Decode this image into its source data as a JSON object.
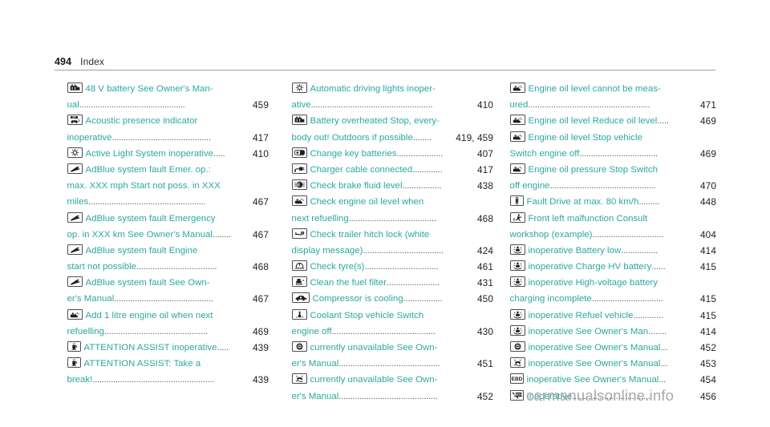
{
  "header": {
    "page_number": "494",
    "section_title": "Index"
  },
  "colors": {
    "entry_text": "#2aa7a4",
    "page_number": "#222222",
    "leader_dots": "#5c5c5c",
    "rule": "#9aa0a0",
    "watermark": "#a8a8a8"
  },
  "watermark": "carmanualsonline.info",
  "columns": [
    {
      "id": "column-1",
      "entries": [
        {
          "icon": "battery-48v-icon",
          "lines": [
            {
              "text": "48 V battery See Owner's Man-",
              "leader": "",
              "page": ""
            },
            {
              "text": "ual",
              "leader": "..............................................",
              "page": "459"
            }
          ]
        },
        {
          "icon": "acoustic-presence-indicator-icon",
          "lines": [
            {
              "text": "Acoustic presence indicator",
              "leader": "",
              "page": ""
            },
            {
              "text": "inoperative",
              "leader": "...........................................",
              "page": "417"
            }
          ]
        },
        {
          "icon": "headlamp-icon",
          "lines": [
            {
              "text": "Active Light System inoperative",
              "leader": ".....",
              "page": "410"
            }
          ]
        },
        {
          "icon": "wrench-icon",
          "lines": [
            {
              "text": "AdBlue system fault Emer. op.:",
              "leader": "",
              "page": ""
            },
            {
              "text": "max. XXX mph Start not poss. in XXX",
              "leader": "",
              "page": ""
            },
            {
              "text": "miles",
              "leader": "...................................................",
              "page": "467"
            }
          ]
        },
        {
          "icon": "wrench-icon",
          "lines": [
            {
              "text": "AdBlue system fault Emergency",
              "leader": "",
              "page": ""
            },
            {
              "text": "op. in XXX km See Owner's Manual",
              "leader": "........",
              "page": "467"
            }
          ]
        },
        {
          "icon": "wrench-icon",
          "lines": [
            {
              "text": "AdBlue system fault Engine",
              "leader": "",
              "page": ""
            },
            {
              "text": "start not possible",
              "leader": "...................................",
              "page": "468"
            }
          ]
        },
        {
          "icon": "wrench-icon",
          "lines": [
            {
              "text": "AdBlue system fault See Own-",
              "leader": "",
              "page": ""
            },
            {
              "text": "er's Manual",
              "leader": "...........................................",
              "page": "467"
            }
          ]
        },
        {
          "icon": "oil-can-icon",
          "lines": [
            {
              "text": "Add 1 litre engine oil when next",
              "leader": "",
              "page": ""
            },
            {
              "text": "refuelling",
              "leader": ".............................................",
              "page": "469"
            }
          ]
        },
        {
          "icon": "attention-assist-coffee-icon",
          "lines": [
            {
              "text": "ATTENTION ASSIST inoperative",
              "leader": ".....",
              "page": "439"
            }
          ]
        },
        {
          "icon": "attention-assist-coffee-icon",
          "lines": [
            {
              "text": "ATTENTION ASSIST: Take a",
              "leader": "",
              "page": ""
            },
            {
              "text": "break!",
              "leader": ".....................................................",
              "page": "439"
            }
          ]
        }
      ]
    },
    {
      "id": "column-2",
      "entries": [
        {
          "icon": "headlamp-icon",
          "lines": [
            {
              "text": "Automatic driving lights inoper-",
              "leader": "",
              "page": ""
            },
            {
              "text": "ative",
              "leader": ".....................................................",
              "page": "410"
            }
          ]
        },
        {
          "icon": "battery-48v-icon",
          "lines": [
            {
              "text": "Battery overheated Stop, every-",
              "leader": "",
              "page": ""
            },
            {
              "text": "body out! Outdoors if possible",
              "leader": "........",
              "page": "419, 459"
            }
          ]
        },
        {
          "icon": "key-battery-icon",
          "lines": [
            {
              "text": "Change key batteries",
              "leader": "....................",
              "page": "407"
            }
          ]
        },
        {
          "icon": "charger-cable-icon",
          "lines": [
            {
              "text": "Charger cable connected",
              "leader": ".............",
              "page": "417"
            }
          ]
        },
        {
          "icon": "brake-fluid-icon",
          "lines": [
            {
              "text": "Check brake fluid level",
              "leader": ".................",
              "page": "438"
            }
          ]
        },
        {
          "icon": "oil-can-icon",
          "lines": [
            {
              "text": "Check engine oil level when",
              "leader": "",
              "page": ""
            },
            {
              "text": "next refuelling",
              "leader": "......................................",
              "page": "468"
            }
          ]
        },
        {
          "icon": "trailer-hitch-icon",
          "lines": [
            {
              "text": "Check trailer hitch lock  (white",
              "leader": "",
              "page": ""
            },
            {
              "text": "display message)",
              "leader": "...................................",
              "page": "424"
            }
          ]
        },
        {
          "icon": "tyre-pressure-icon",
          "lines": [
            {
              "text": "Check tyre(s)",
              "leader": "................................",
              "page": "461"
            }
          ]
        },
        {
          "icon": "fuel-filter-icon",
          "lines": [
            {
              "text": "Clean the fuel filter",
              "leader": ".......................",
              "page": "431"
            }
          ]
        },
        {
          "icon": "compressor-cooling-icon",
          "lines": [
            {
              "text": "Compressor is cooling",
              "leader": ".................",
              "page": "450"
            }
          ]
        },
        {
          "icon": "coolant-temperature-icon",
          "lines": [
            {
              "text": "Coolant Stop vehicle Switch",
              "leader": "",
              "page": ""
            },
            {
              "text": "engine off",
              "leader": ".............................................",
              "page": "430"
            }
          ]
        },
        {
          "icon": "esp-off-icon",
          "lines": [
            {
              "text": "currently unavailable See Own-",
              "leader": "",
              "page": ""
            },
            {
              "text": "er's Manual",
              "leader": "............................................",
              "page": "451"
            }
          ]
        },
        {
          "icon": "esp-skid-icon",
          "lines": [
            {
              "text": "currently unavailable See Own-",
              "leader": "",
              "page": ""
            },
            {
              "text": "er's Manual",
              "leader": "...........................................",
              "page": "452"
            }
          ]
        }
      ]
    },
    {
      "id": "column-3",
      "entries": [
        {
          "icon": "oil-can-icon",
          "lines": [
            {
              "text": "Engine oil level cannot be meas-",
              "leader": "",
              "page": ""
            },
            {
              "text": "ured",
              "leader": ".....................................................",
              "page": "471"
            }
          ]
        },
        {
          "icon": "oil-can-icon",
          "lines": [
            {
              "text": "Engine oil level Reduce oil level",
              "leader": ".....",
              "page": "469"
            }
          ]
        },
        {
          "icon": "oil-can-icon",
          "lines": [
            {
              "text": "Engine oil level Stop vehicle",
              "leader": "",
              "page": ""
            },
            {
              "text": "Switch engine off",
              "leader": "..................................",
              "page": "469"
            }
          ]
        },
        {
          "icon": "oil-can-icon",
          "lines": [
            {
              "text": "Engine oil pressure Stop Switch",
              "leader": "",
              "page": ""
            },
            {
              "text": "off engine",
              "leader": "..............................................",
              "page": "470"
            }
          ]
        },
        {
          "icon": "seatbelt-pretensioner-icon",
          "lines": [
            {
              "text": "Fault Drive at max. 80 km/h",
              "leader": ".........",
              "page": "448"
            }
          ]
        },
        {
          "icon": "pedestrian-warning-icon",
          "lines": [
            {
              "text": "Front left malfunction Consult",
              "leader": "",
              "page": ""
            },
            {
              "text": "workshop (example)",
              "leader": "...............................",
              "page": "404"
            }
          ]
        },
        {
          "icon": "airbag-icon",
          "lines": [
            {
              "text": "inoperative Battery low",
              "leader": "................",
              "page": "414"
            }
          ]
        },
        {
          "icon": "airbag-icon",
          "lines": [
            {
              "text": "inoperative Charge HV battery",
              "leader": "......",
              "page": "415"
            }
          ]
        },
        {
          "icon": "airbag-icon",
          "lines": [
            {
              "text": "inoperative High-voltage battery",
              "leader": "",
              "page": ""
            },
            {
              "text": "charging incomplete",
              "leader": "...............................",
              "page": "415"
            }
          ]
        },
        {
          "icon": "airbag-icon",
          "lines": [
            {
              "text": "inoperative Refuel vehicle",
              "leader": ".............",
              "page": "415"
            }
          ]
        },
        {
          "icon": "airbag-icon",
          "lines": [
            {
              "text": "inoperative See Owner's Man",
              "leader": "........",
              "page": "414"
            }
          ]
        },
        {
          "icon": "esp-off-icon",
          "lines": [
            {
              "text": "inoperative See Owner's Manual",
              "leader": "...",
              "page": "452"
            }
          ]
        },
        {
          "icon": "esp-skid-icon",
          "lines": [
            {
              "text": "inoperative See Owner's Manual",
              "leader": "...",
              "page": "453"
            }
          ]
        },
        {
          "icon": "ebd-icon",
          "lines": [
            {
              "text": "inoperative See Owner's Manual",
              "leader": "...",
              "page": "454"
            }
          ]
        },
        {
          "icon": "sos-call-icon",
          "lines": [
            {
              "text": "Inoperative",
              "leader": "...................................",
              "page": "456"
            }
          ]
        }
      ]
    }
  ]
}
